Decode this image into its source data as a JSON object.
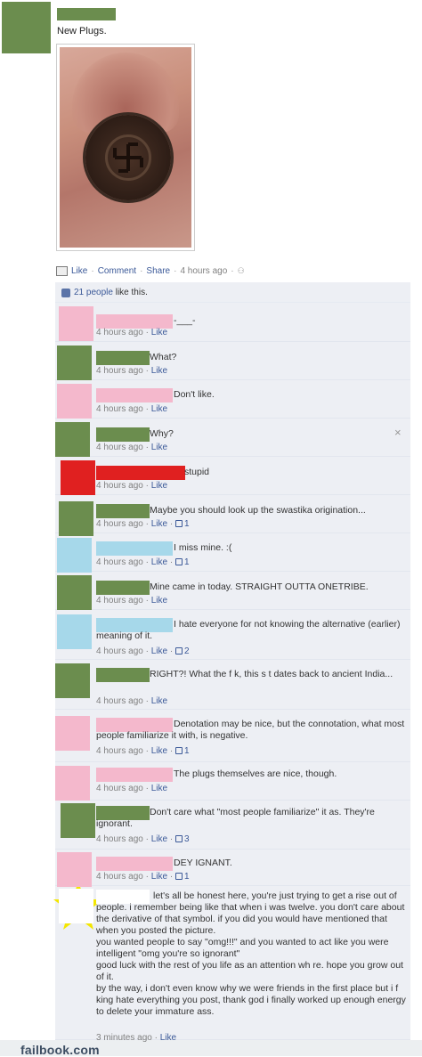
{
  "post": {
    "text": "New Plugs.",
    "actions": {
      "like": "Like",
      "comment": "Comment",
      "share": "Share",
      "time": "4 hours ago"
    },
    "likes": {
      "count_text": "21 people",
      "suffix": "like this."
    }
  },
  "comments": [
    {
      "text": "-___-",
      "time": "4 hours ago",
      "like": "Like",
      "likes": "",
      "avatar_color": "#f4b8cc"
    },
    {
      "text": "What?",
      "time": "4 hours ago",
      "like": "Like",
      "likes": "",
      "avatar_color": "#6b8d4e"
    },
    {
      "text": "Don't like.",
      "time": "4 hours ago",
      "like": "Like",
      "likes": "",
      "avatar_color": "#f4b8cc"
    },
    {
      "text": "Why?",
      "time": "4 hours ago",
      "like": "Like",
      "likes": "",
      "avatar_color": "#6b8d4e"
    },
    {
      "text": "stupid",
      "time": "4 hours ago",
      "like": "Like",
      "likes": "",
      "avatar_color": "#e02020"
    },
    {
      "text": "Maybe you should look up the swastika origination...",
      "time": "4 hours ago",
      "like": "Like",
      "likes": "1",
      "avatar_color": "#6b8d4e"
    },
    {
      "text": "I miss mine. :(",
      "time": "4 hours ago",
      "like": "Like",
      "likes": "1",
      "avatar_color": "#a6d8ea"
    },
    {
      "text": "Mine came in today. STRAIGHT OUTTA ONETRIBE.",
      "time": "4 hours ago",
      "like": "Like",
      "likes": "",
      "avatar_color": "#6b8d4e"
    },
    {
      "text": "I hate everyone for not knowing the alternative (earlier) meaning of it.",
      "time": "4 hours ago",
      "like": "Like",
      "likes": "2",
      "avatar_color": "#a6d8ea"
    },
    {
      "text": "RIGHT?! What the f  k, this s  t dates back to ancient India...",
      "time": "4 hours ago",
      "like": "Like",
      "likes": "",
      "avatar_color": "#6b8d4e"
    },
    {
      "text": "Denotation may be nice, but the connotation, what most people familiarize it with, is negative.",
      "time": "4 hours ago",
      "like": "Like",
      "likes": "1",
      "avatar_color": "#f4b8cc"
    },
    {
      "text": "The plugs themselves are nice, though.",
      "time": "4 hours ago",
      "like": "Like",
      "likes": "",
      "avatar_color": "#f4b8cc"
    },
    {
      "text": "Don't care what \"most people familiarize\" it as. They're ignorant.",
      "time": "4 hours ago",
      "like": "Like",
      "likes": "3",
      "avatar_color": "#6b8d4e"
    },
    {
      "text": "DEY IGNANT.",
      "time": "4 hours ago",
      "like": "Like",
      "likes": "1",
      "avatar_color": "#f4b8cc"
    },
    {
      "text": "let's all be honest here, you're just trying to get a rise out of people. i remember being like that when i was twelve. you don't care about the derivative of that symbol. if you did you would have mentioned that when you posted the picture.\nyou wanted people to say \"omg!!!\" and you wanted to act like you were intelligent \"omg you're so ignorant\"\ngood luck with the rest of you life as an attention wh   re. hope you grow out of it.\nby the way, i don't even know why we were friends in the first place but i f   king hate everything you post, thank god i finally worked up enough energy to delete your immature ass.",
      "time": "3 minutes ago",
      "like": "Like",
      "likes": "",
      "avatar_color": "#ffffff"
    }
  ],
  "footer": {
    "brand": "failbook.com"
  },
  "colors": {
    "link": "#3b5998",
    "feedback_bg": "#edeff4",
    "green_censor": "#6b8d4e",
    "pink_censor": "#f4b8cc",
    "blue_censor": "#a6d8ea",
    "red_censor": "#e02020",
    "star": "#f3e600"
  },
  "icons": {
    "close": "×",
    "star": "star-icon",
    "thumb": "thumbs-up-icon"
  }
}
